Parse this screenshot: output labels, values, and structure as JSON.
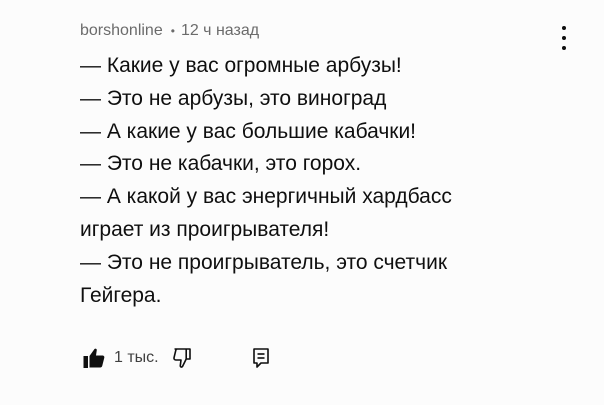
{
  "comment": {
    "author": "borshonline",
    "separator": "•",
    "time": "12 ч назад",
    "lines": [
      "— Какие у вас огромные арбузы!",
      "— Это не арбузы, это виноград",
      "— А какие у вас большие кабачки!",
      "— Это не кабачки, это горох.",
      "— А какой у вас энергичный хардбасс",
      "играет из проигрывателя!",
      "— Это не проигрыватель, это счетчик",
      "Гейгера."
    ],
    "likes": "1 тыс.",
    "icons": {
      "menu": "more-vert-icon",
      "like": "thumb-up-icon",
      "dislike": "thumb-down-icon",
      "reply": "reply-icon"
    },
    "colors": {
      "text": "#0f0f0f",
      "meta": "#6b6b6b"
    }
  }
}
